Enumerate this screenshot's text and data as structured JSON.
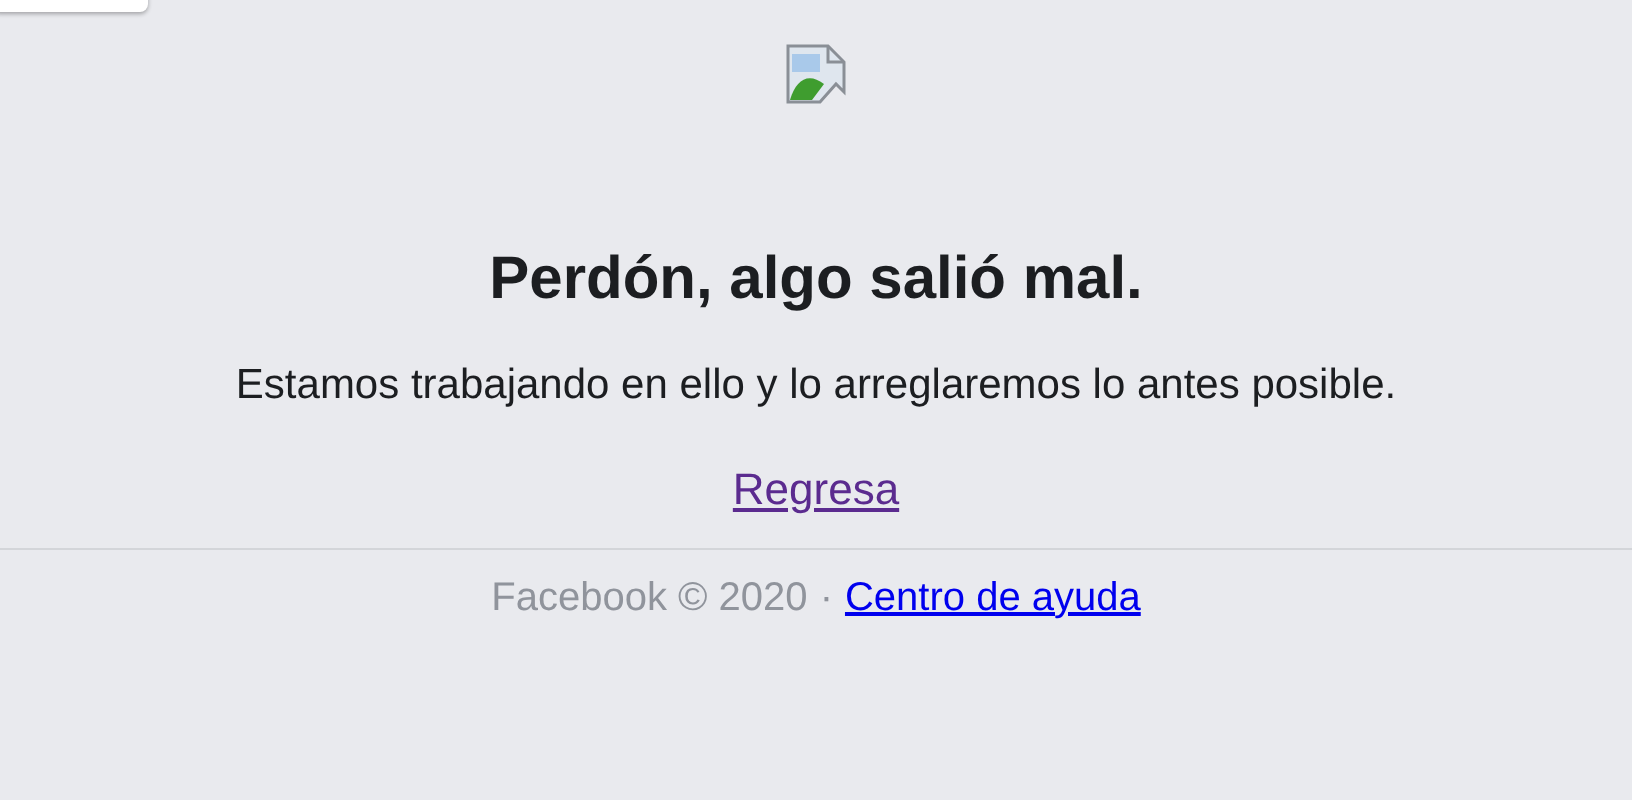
{
  "error": {
    "title": "Perdón, algo salió mal.",
    "message": "Estamos trabajando en ello y lo arreglaremos lo antes posible.",
    "back_link": {
      "label": "Regresa",
      "visited": true
    }
  },
  "footer": {
    "copyright": "Facebook © 2020",
    "separator": "·",
    "help_link": {
      "label": "Centro de ayuda",
      "visited": false
    }
  }
}
